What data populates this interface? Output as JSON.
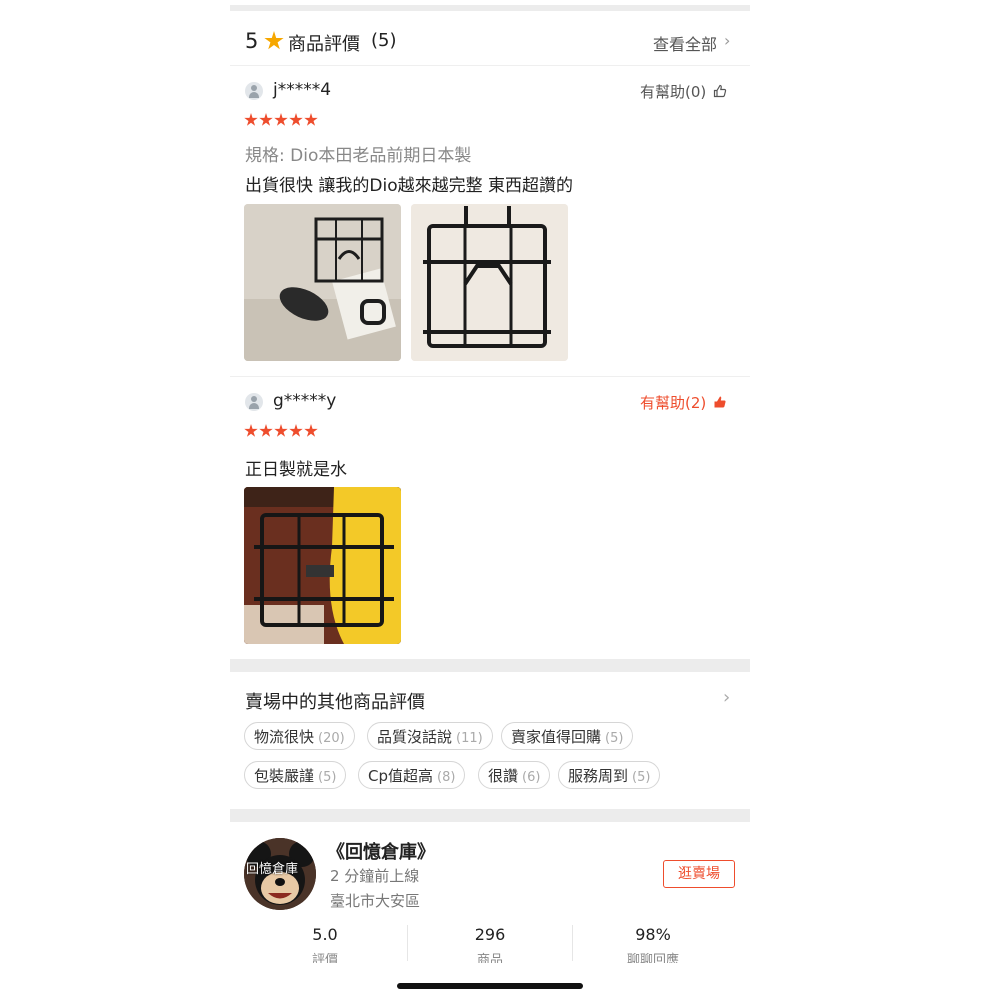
{
  "ratings_header": {
    "score": "5",
    "title": "商品評價",
    "count": "(5)",
    "view_all": "查看全部"
  },
  "reviews": [
    {
      "username": "j*****4",
      "helpful_label": "有幫助",
      "helpful_count": "(0)",
      "helpful_active": false,
      "stars": 5,
      "spec": "規格: Dio本田老品前期日本製",
      "text": "出貨很快 讓我的Dio越來越完整 東西超讚的",
      "photos": [
        "rack-photo-1",
        "rack-photo-2"
      ]
    },
    {
      "username": "g*****y",
      "helpful_label": "有幫助",
      "helpful_count": "(2)",
      "helpful_active": true,
      "stars": 5,
      "text": "正日製就是水",
      "photos": [
        "rack-photo-3"
      ]
    }
  ],
  "shop_reviews": {
    "title": "賣場中的其他商品評價",
    "tags": [
      {
        "label": "物流很快",
        "count": "(20)"
      },
      {
        "label": "品質沒話說",
        "count": "(11)"
      },
      {
        "label": "賣家值得回購",
        "count": "(5)"
      },
      {
        "label": "包裝嚴謹",
        "count": "(5)"
      },
      {
        "label": "Cp值超高",
        "count": "(8)"
      },
      {
        "label": "很讚",
        "count": "(6)"
      },
      {
        "label": "服務周到",
        "count": "(5)"
      }
    ]
  },
  "shop": {
    "name": "《回憶倉庫》",
    "avatar_text": "回憶倉庫",
    "online": "2 分鐘前上線",
    "location": "臺北市大安區",
    "visit_button": "逛賣場",
    "stats": [
      {
        "value": "5.0",
        "label": "評價"
      },
      {
        "value": "296",
        "label": "商品"
      },
      {
        "value": "98%",
        "label": "聊聊回應"
      }
    ]
  },
  "colors": {
    "accent": "#ee4d2d",
    "star_header": "#f6a700"
  }
}
